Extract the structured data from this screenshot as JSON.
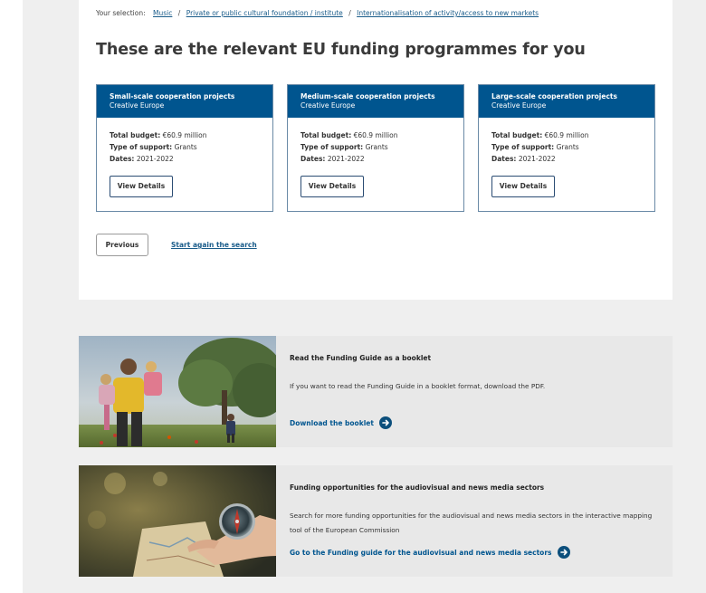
{
  "breadcrumb": {
    "prefix": "Your selection:",
    "items": [
      "Music",
      "Private or public cultural foundation / institute",
      "Internationalisation of activity/access to new markets"
    ],
    "separator": "/"
  },
  "headline": "These are the relevant EU funding programmes for you",
  "programmes": [
    {
      "title": "Small-scale cooperation projects",
      "subtitle": "Creative Europe",
      "budget_label": "Total budget:",
      "budget": "€60.9 million",
      "support_label": "Type of support:",
      "support": "Grants",
      "dates_label": "Dates:",
      "dates": "2021-2022",
      "button": "View Details"
    },
    {
      "title": "Medium-scale cooperation projects",
      "subtitle": "Creative Europe",
      "budget_label": "Total budget:",
      "budget": "€60.9 million",
      "support_label": "Type of support:",
      "support": "Grants",
      "dates_label": "Dates:",
      "dates": "2021-2022",
      "button": "View Details"
    },
    {
      "title": "Large-scale cooperation projects",
      "subtitle": "Creative Europe",
      "budget_label": "Total budget:",
      "budget": "€60.9 million",
      "support_label": "Type of support:",
      "support": "Grants",
      "dates_label": "Dates:",
      "dates": "2021-2022",
      "button": "View Details"
    }
  ],
  "nav": {
    "previous": "Previous",
    "restart": "Start again the search"
  },
  "promos": [
    {
      "title": "Read the Funding Guide as a booklet",
      "description": "If you want to read the Funding Guide in a booklet format, download the PDF.",
      "link": "Download the booklet",
      "image": "family-walking-field-photo"
    },
    {
      "title": "Funding opportunities for the audiovisual and news media sectors",
      "description": "Search for more funding opportunities for the audiovisual and news media sectors in the interactive mapping tool of the European Commission",
      "link": "Go to the Funding guide for the audiovisual and news media sectors",
      "image": "hand-compass-map-photo"
    }
  ],
  "colors": {
    "header_blue": "#00558f",
    "link_blue": "#1a5c8a",
    "arrow_blue": "#0c4f7c",
    "page_grey": "#efefef",
    "promo_grey": "#e8e8e8"
  },
  "icons": {
    "promo_link": "arrow-right-circle-icon"
  }
}
